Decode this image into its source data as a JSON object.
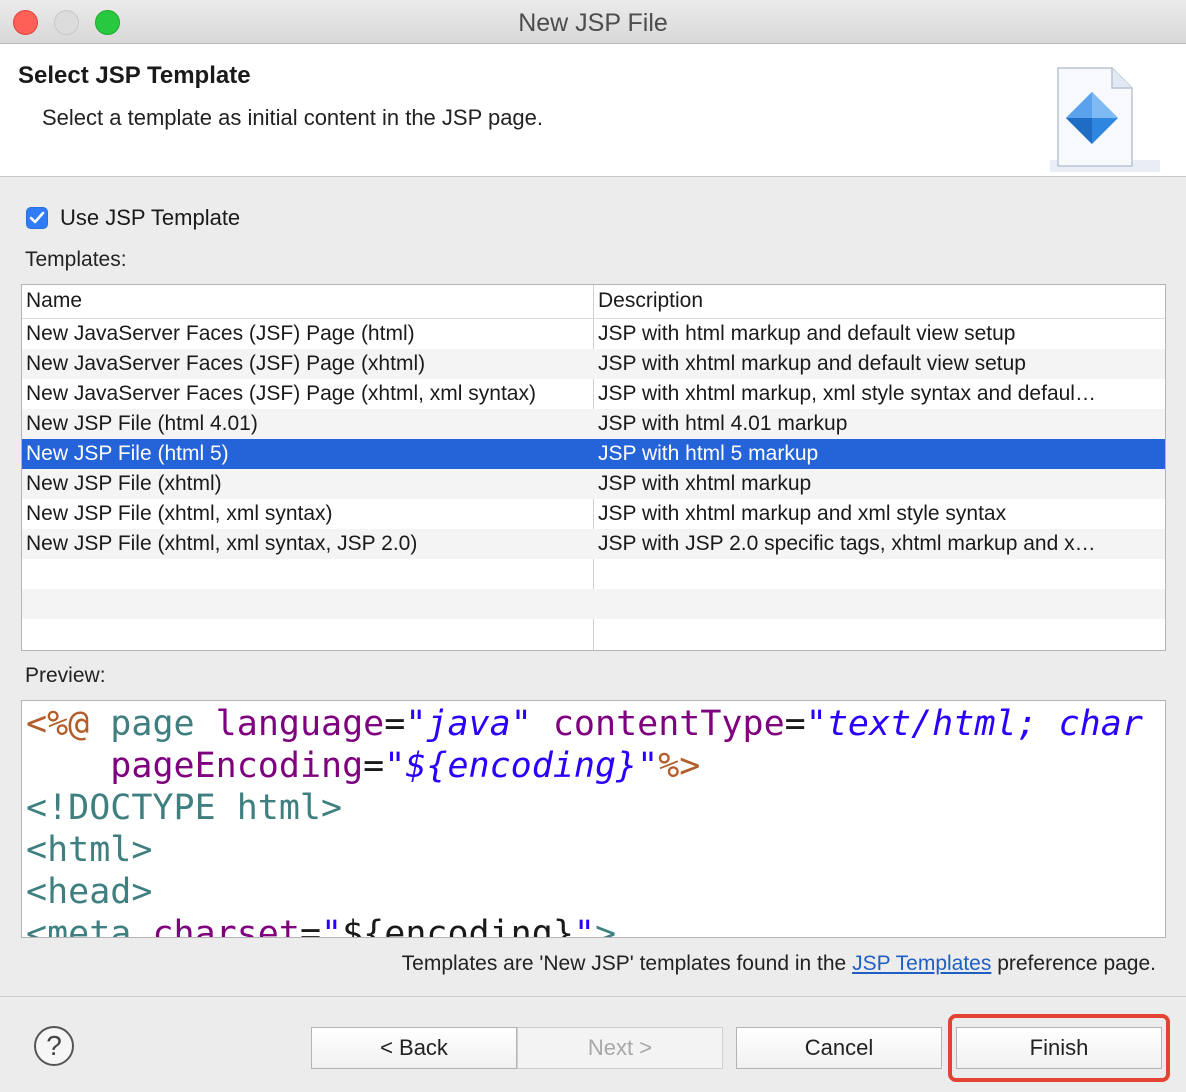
{
  "window": {
    "title": "New JSP File"
  },
  "header": {
    "title": "Select JSP Template",
    "description": "Select a template as initial content in the JSP page."
  },
  "use_template": {
    "label": "Use JSP Template",
    "checked": true
  },
  "templates": {
    "label": "Templates:",
    "columns": [
      "Name",
      "Description"
    ],
    "rows": [
      {
        "name": "New JavaServer Faces (JSF) Page (html)",
        "description": "JSP with html markup and default view setup"
      },
      {
        "name": "New JavaServer Faces (JSF) Page (xhtml)",
        "description": "JSP with xhtml markup and default view setup"
      },
      {
        "name": "New JavaServer Faces (JSF) Page (xhtml, xml syntax)",
        "description": "JSP with xhtml markup, xml style syntax and defaul…"
      },
      {
        "name": "New JSP File (html 4.01)",
        "description": "JSP with html 4.01 markup"
      },
      {
        "name": "New JSP File (html 5)",
        "description": "JSP with html 5 markup",
        "selected": true
      },
      {
        "name": "New JSP File (xhtml)",
        "description": "JSP with xhtml markup"
      },
      {
        "name": "New JSP File (xhtml, xml syntax)",
        "description": "JSP with xhtml markup and xml style syntax"
      },
      {
        "name": "New JSP File (xhtml, xml syntax, JSP 2.0)",
        "description": "JSP with JSP 2.0 specific tags, xhtml markup and x…"
      }
    ]
  },
  "preview": {
    "label": "Preview:",
    "tokens": {
      "open_directive": "<%@",
      "page": "page",
      "language_attr": "language",
      "equals": "=",
      "quote": "\"",
      "language_val": "java",
      "contenttype_attr": "contentType",
      "contenttype_val": "text/html; char",
      "pageencoding_attr": "pageEncoding",
      "encoding_val": "${encoding}",
      "close_directive": "%>",
      "doctype": "<!DOCTYPE html>",
      "html_tag": "<html>",
      "head_tag": "<head>",
      "meta_open": "<meta",
      "charset_attr": "charset",
      "encoding_plain": "${encoding}",
      "tag_close": ">"
    }
  },
  "footer": {
    "note_before": "Templates are 'New JSP' templates found in the ",
    "link": "JSP Templates",
    "note_after": " preference page."
  },
  "buttons": {
    "help": "?",
    "back": "< Back",
    "next": "Next >",
    "cancel": "Cancel",
    "finish": "Finish"
  },
  "colors": {
    "selection": "#2563d8",
    "checkbox": "#2f7cf6",
    "highlight": "#e44332",
    "link": "#1f5fc4"
  }
}
